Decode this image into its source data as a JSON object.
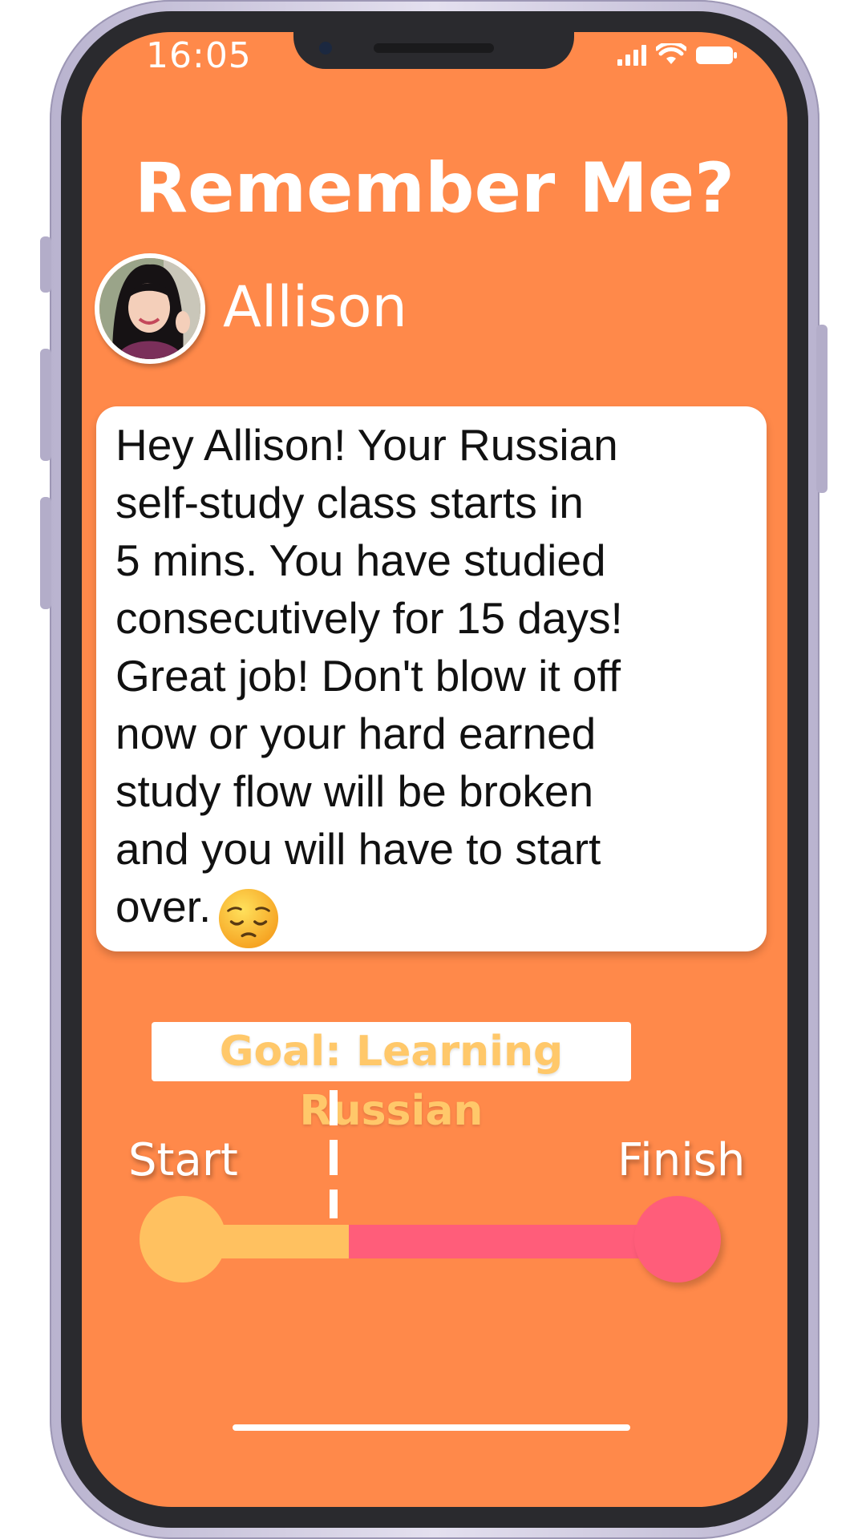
{
  "status_bar": {
    "time": "16:05"
  },
  "header": {
    "title": "Remember Me?"
  },
  "user": {
    "name": "Allison"
  },
  "message": {
    "text": "Hey Allison! Your Russian\nself-study class starts in\n5 mins. You have studied\nconsecutively for 15 days!\nGreat job! Don't blow it off\nnow or your hard earned\nstudy flow will be broken\nand you will have to start\nover.",
    "emoji": "pensive-face-icon"
  },
  "goal": {
    "label": "Goal: Learning Russian",
    "start_label": "Start",
    "finish_label": "Finish",
    "progress": 0.33
  },
  "colors": {
    "screen_background": "#ff894a",
    "progress_done": "#ffc160",
    "progress_remaining": "#ff5d7a",
    "goal_text": "#ffc86a"
  }
}
